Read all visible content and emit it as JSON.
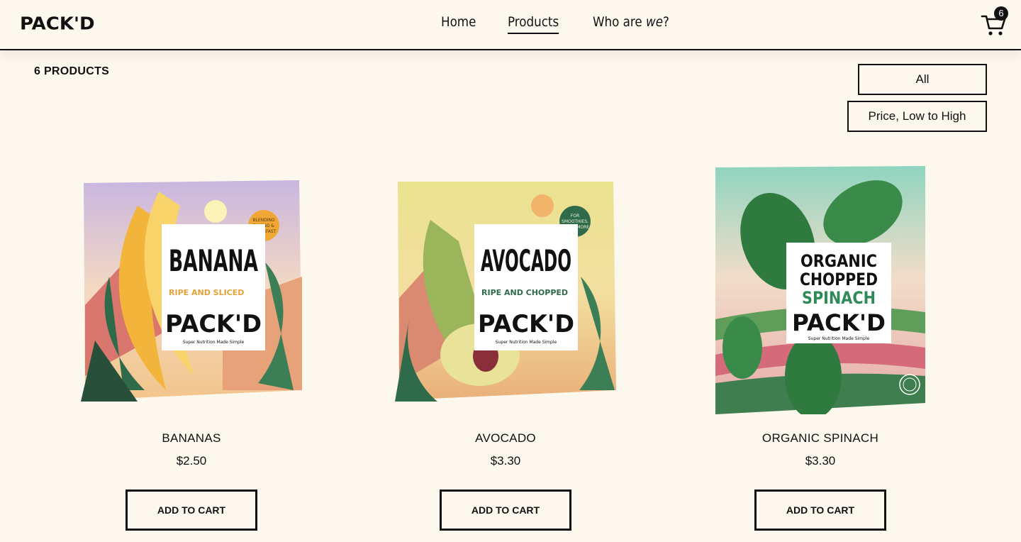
{
  "header": {
    "logo": "PACK'D",
    "nav": [
      {
        "label": "Home"
      },
      {
        "label": "Products"
      },
      {
        "label_pre": "Who are ",
        "label_em": "we",
        "label_post": "?"
      }
    ],
    "cart_count": "6"
  },
  "listing": {
    "count_label": "6 PRODUCTS",
    "filter_label": "All",
    "sort_label": "Price, Low to High"
  },
  "products": [
    {
      "name": "BANANAS",
      "price": "$2.50",
      "button": "ADD TO CART",
      "pack": {
        "title": "BANANA",
        "subtitle": "RIPE AND SLICED",
        "brand": "PACK'D",
        "tagline": "Super Nutrition Made Simple",
        "badge": "BLENDING BAKING & BREAKFAST"
      }
    },
    {
      "name": "AVOCADO",
      "price": "$3.30",
      "button": "ADD TO CART",
      "pack": {
        "title": "AVOCADO",
        "subtitle": "RIPE AND CHOPPED",
        "brand": "PACK'D",
        "tagline": "Super Nutrition Made Simple",
        "badge": "FOR SMOOTHIES, DIPS & MORE"
      }
    },
    {
      "name": "ORGANIC SPINACH",
      "price": "$3.30",
      "button": "ADD TO CART",
      "pack": {
        "title_l1": "ORGANIC",
        "title_l2": "CHOPPED",
        "subtitle": "SPINACH",
        "brand": "PACK'D",
        "tagline": "Super Nutrition Made Simple"
      }
    }
  ],
  "colors": {
    "background": "#fdf8ee",
    "ink": "#111111",
    "banana_badge": "#f0a733",
    "avocado_badge": "#2f6b4a",
    "spinach_green": "#2e8b57"
  }
}
